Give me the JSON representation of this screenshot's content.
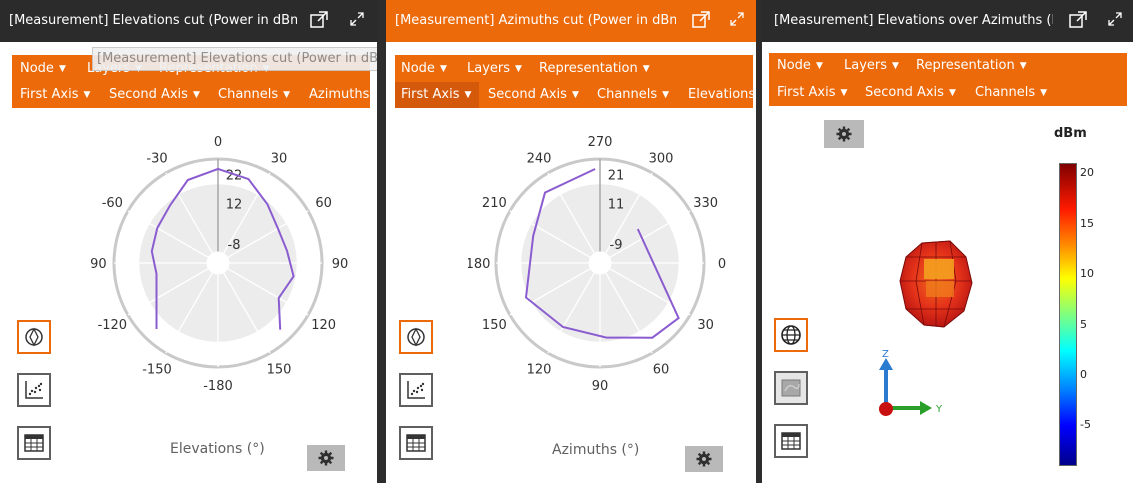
{
  "panel1": {
    "title": "[Measurement] Elevations cut (Power in dBm)",
    "tooltip": "[Measurement] Elevations cut (Power in dBm)",
    "toolbar_row1": [
      "Node",
      "Layers",
      "Representation"
    ],
    "toolbar_row2": [
      "First Axis",
      "Second Axis",
      "Channels",
      "Azimuths"
    ],
    "axis_label": "Elevations (°)",
    "angle_labels": [
      "0",
      "30",
      "60",
      "90",
      "120",
      "150",
      "-180",
      "-150",
      "-120",
      "-90",
      "-60",
      "-30"
    ],
    "radial_labels": [
      "22",
      "12",
      "-8"
    ],
    "series_color": "#8a5cd0"
  },
  "panel2": {
    "title": "[Measurement] Azimuths cut (Power in dBm)",
    "toolbar_row1": [
      "Node",
      "Layers",
      "Representation"
    ],
    "toolbar_row2": [
      "First Axis",
      "Second Axis",
      "Channels",
      "Elevations"
    ],
    "axis_label": "Azimuths (°)",
    "angle_labels": [
      "270",
      "300",
      "330",
      "0",
      "30",
      "60",
      "90",
      "120",
      "150",
      "180",
      "210",
      "240"
    ],
    "radial_labels": [
      "21",
      "11",
      "-9"
    ],
    "series_color": "#8a5cd0"
  },
  "panel3": {
    "title": "[Measurement] Elevations over Azimuths (Power in dBm)",
    "toolbar_row1": [
      "Node",
      "Layers",
      "Representation"
    ],
    "toolbar_row2": [
      "First Axis",
      "Second Axis",
      "Channels"
    ],
    "colorbar_unit": "dBm",
    "colorbar_ticks": [
      "20",
      "15",
      "10",
      "5",
      "0",
      "-5"
    ],
    "axis_z": "Z",
    "axis_y": "Y"
  },
  "icons": {
    "popout": "popout-icon",
    "maximize": "maximize-icon",
    "settings": "gear-icon",
    "polar_view": "polar-view-icon",
    "scatter_view": "scatter-plot-icon",
    "table_view": "table-icon",
    "globe_view": "globe-icon",
    "surface_view": "surface-view-icon"
  },
  "colors": {
    "accent": "#ec6a0a",
    "titlebar": "#2b2b2b",
    "gear_button": "#b9b9b9"
  }
}
